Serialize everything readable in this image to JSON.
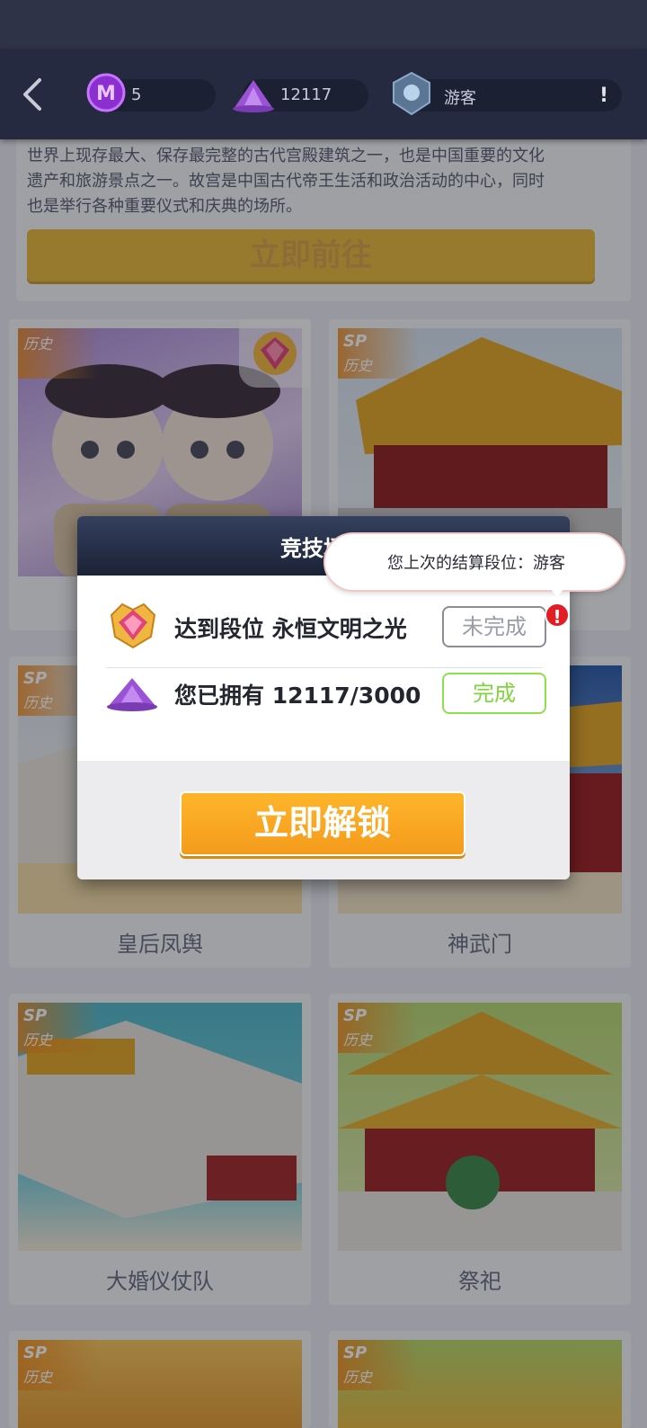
{
  "topbar": {
    "medal_count": "5",
    "gem_count": "12117",
    "rank_label": "游客",
    "alert_label": "!"
  },
  "intro": {
    "text_line1": "世界上现存最大、保存最完整的古代宫殿建筑之一，也是中国重要的文化",
    "text_line2": "遗产和旅游景点之一。故宫是中国古代帝王生活和政治活动的中心，同时",
    "text_line3": "也是举行各种重要仪式和庆典的场所。",
    "go_button": "立即前往"
  },
  "cards": [
    {
      "label": "",
      "tag_sp": "",
      "tag_hist": "历史"
    },
    {
      "label": "",
      "tag_sp": "SP",
      "tag_hist": "历史"
    },
    {
      "label": "皇后凤舆",
      "tag_sp": "SP",
      "tag_hist": "历史"
    },
    {
      "label": "神武门",
      "tag_sp": "SP",
      "tag_hist": "历史"
    },
    {
      "label": "大婚仪仗队",
      "tag_sp": "SP",
      "tag_hist": "历史"
    },
    {
      "label": "祭祀",
      "tag_sp": "SP",
      "tag_hist": "历史"
    },
    {
      "label": "",
      "tag_sp": "SP",
      "tag_hist": "历史"
    },
    {
      "label": "",
      "tag_sp": "SP",
      "tag_hist": "历史"
    }
  ],
  "modal": {
    "title": "竞技场兑",
    "requirement_rank": "达到段位 永恒文明之光",
    "requirement_rank_status": "未完成",
    "requirement_gems": "您已拥有 12117/3000",
    "requirement_gems_status": "完成",
    "unlock_button": "立即解锁"
  },
  "tooltip": {
    "text": "您上次的结算段位：游客"
  },
  "colors": {
    "accent_orange": "#f49a1c",
    "done_green": "#7fd53b",
    "alert_red": "#e21d26"
  }
}
